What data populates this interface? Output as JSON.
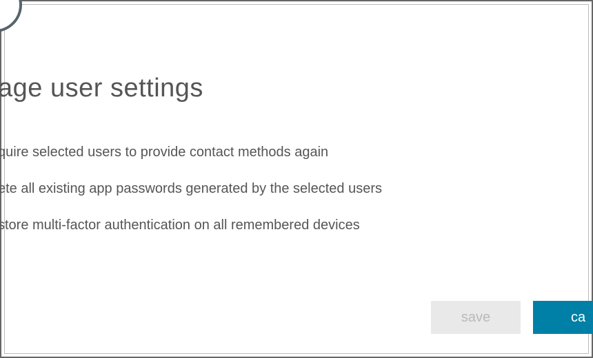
{
  "dialog": {
    "title": "age user settings",
    "options": [
      {
        "label": "quire selected users to provide contact methods again"
      },
      {
        "label": "ete all existing app passwords generated by the selected users"
      },
      {
        "label": "store multi-factor authentication on all remembered devices"
      }
    ],
    "buttons": {
      "save_label": "save",
      "cancel_label": "ca"
    }
  }
}
